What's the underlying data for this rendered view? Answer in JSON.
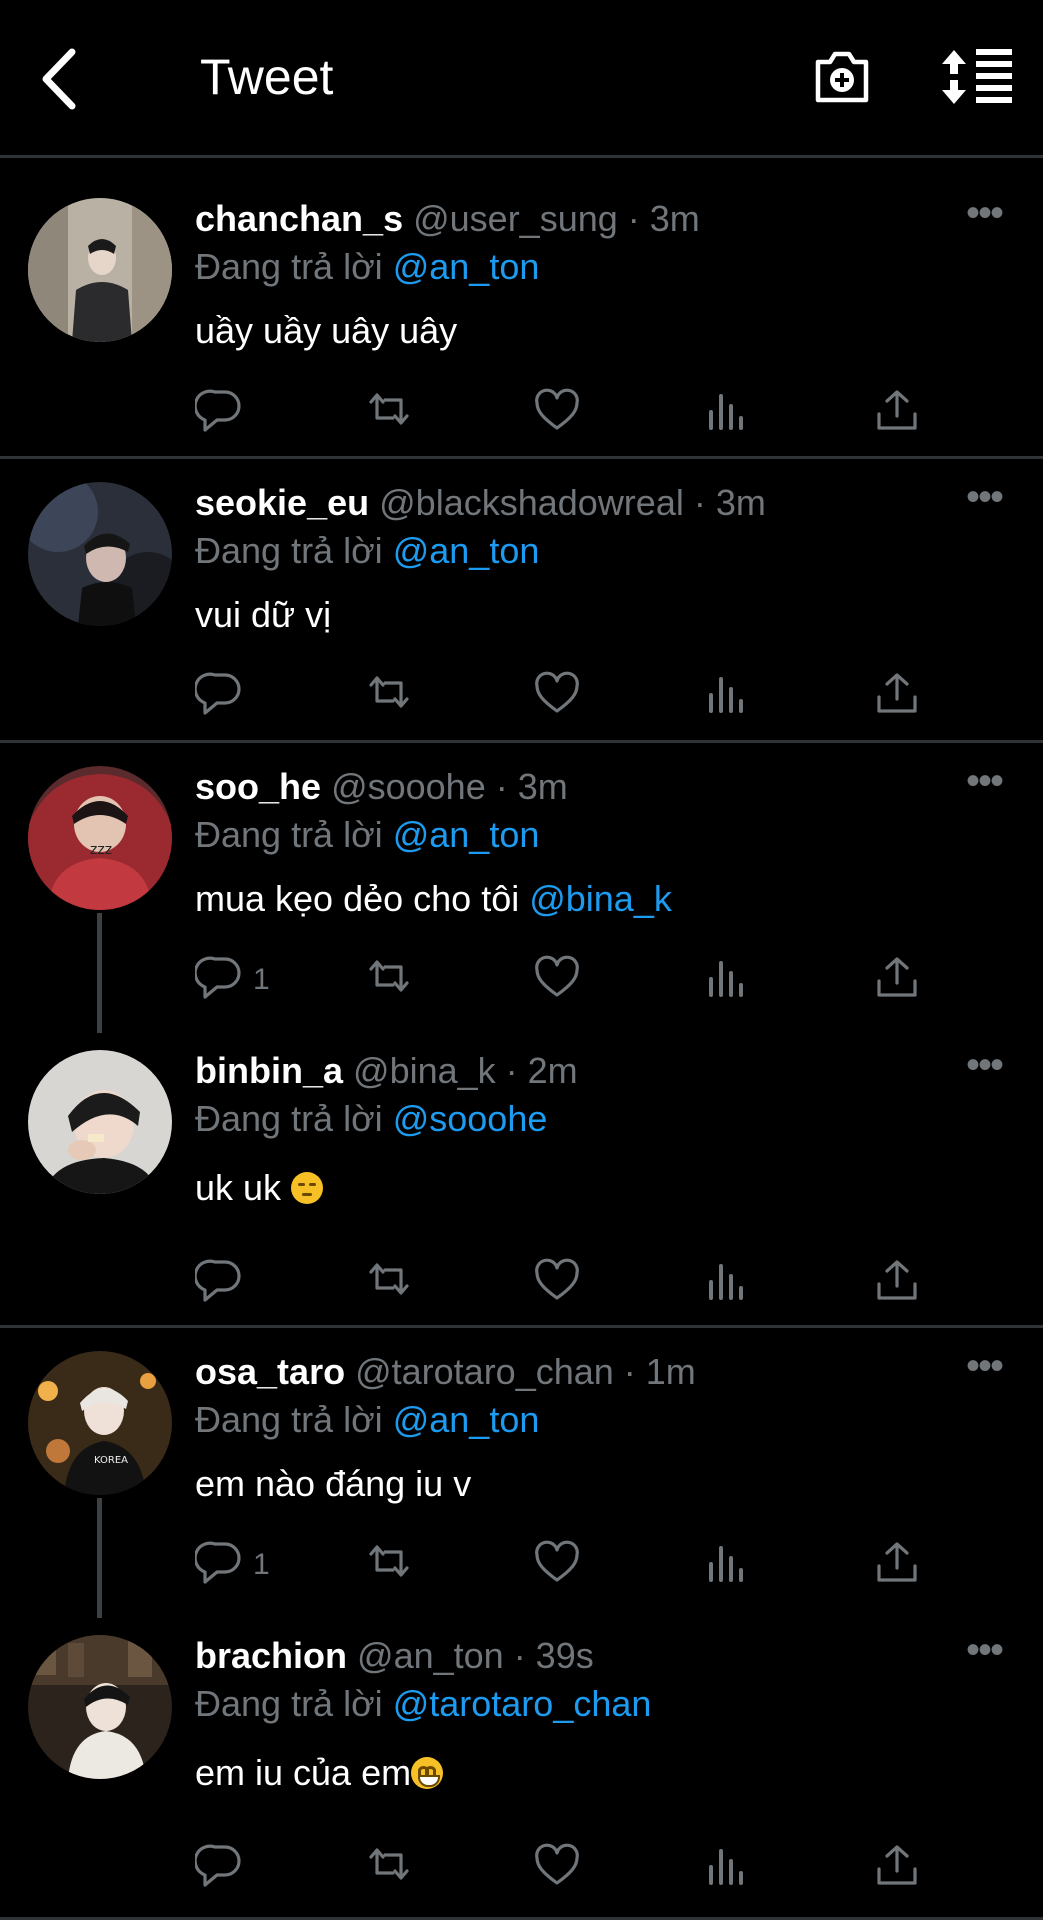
{
  "header": {
    "title": "Tweet",
    "back_icon": "chevron-left-icon",
    "camera_icon": "camera-plus-icon",
    "sort_icon": "sort-list-icon"
  },
  "reply_prefix": "Đang trả lời",
  "colors": {
    "accent": "#1d9bf0",
    "muted": "#71767b",
    "background": "#000000",
    "divider": "#2f3336"
  },
  "tweets": [
    {
      "name": "chanchan_s",
      "meta": "@user_sung · 3m",
      "reply_to": "@an_ton",
      "text": "uầy uầy uây uây",
      "text_mention": "",
      "emoji": "",
      "reply_count": ""
    },
    {
      "name": "seokie_eu",
      "meta": "@blackshadowreal · 3m",
      "reply_to": "@an_ton",
      "text": "vui dữ vị",
      "text_mention": "",
      "emoji": "",
      "reply_count": ""
    },
    {
      "name": "soo_he",
      "meta": "@sooohe · 3m",
      "reply_to": "@an_ton",
      "text": "mua kẹo dẻo cho tôi ",
      "text_mention": "@bina_k",
      "emoji": "",
      "reply_count": "1"
    },
    {
      "name": "binbin_a",
      "meta": "@bina_k · 2m",
      "reply_to": "@sooohe",
      "text": "uk uk ",
      "text_mention": "",
      "emoji": "pensive-face",
      "reply_count": ""
    },
    {
      "name": "osa_taro",
      "meta": "@tarotaro_chan · 1m",
      "reply_to": "@an_ton",
      "text": "em nào đáng iu v",
      "text_mention": "",
      "emoji": "",
      "reply_count": "1"
    },
    {
      "name": "brachion",
      "meta": "@an_ton · 39s",
      "reply_to": "@tarotaro_chan",
      "text": "em iu của em",
      "text_mention": "",
      "emoji": "grinning-face",
      "reply_count": ""
    }
  ]
}
